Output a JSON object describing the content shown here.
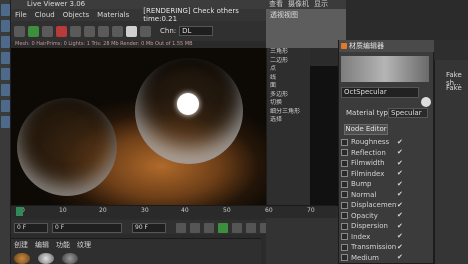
{
  "live_viewer": {
    "title": "Live Viewer 3.06",
    "menu": [
      "File",
      "Cloud",
      "Objects",
      "Materials"
    ],
    "status": "[RENDERING] Check others time:0.21",
    "chn_label": "Chn:",
    "chn_value": "DL",
    "stats": "Mesh: 0  HairPrims: 0  Lights: 1  Tris: 28 Mb  Render: 0 Mb  Out of 1.55 MB"
  },
  "viewport": {
    "label": "透视视图",
    "menu": [
      "查看",
      "摄像机",
      "显示"
    ]
  },
  "properties": {
    "items": [
      "三角形",
      "二边形",
      "点",
      "线",
      "面",
      "多边形",
      "切换",
      "细分三角形",
      "选择",
      "...",
      "..."
    ]
  },
  "material_editor": {
    "title": "材质编辑器",
    "material_name": "OctSpecular",
    "material_type_label": "Material type",
    "material_type_value": "Specular",
    "node_editor_label": "Node Editor",
    "channels": [
      {
        "label": "Roughness",
        "checked": "✔"
      },
      {
        "label": "Reflection",
        "checked": "✔"
      },
      {
        "label": "Filmwidth",
        "checked": "✔"
      },
      {
        "label": "Filmindex",
        "checked": "✔"
      },
      {
        "label": "Bump",
        "checked": "✔"
      },
      {
        "label": "Normal",
        "checked": "✔"
      },
      {
        "label": "Displacement",
        "checked": "✔"
      },
      {
        "label": "Opacity",
        "checked": "✔"
      },
      {
        "label": "Dispersion",
        "checked": "✔"
      },
      {
        "label": "Index",
        "checked": "✔"
      },
      {
        "label": "Transmission",
        "checked": "✔"
      },
      {
        "label": "Medium",
        "checked": "✔"
      }
    ]
  },
  "right_panel": {
    "line1": "Fake sh...",
    "line2": "Fake"
  },
  "timeline": {
    "ticks": [
      "0",
      "10",
      "20",
      "30",
      "40",
      "50",
      "60",
      "70"
    ],
    "start_field": "0 F",
    "current_field": "0 F",
    "end_field": "90 F"
  },
  "bottom_panel": {
    "menu": [
      "创建",
      "编辑",
      "功能",
      "纹理"
    ]
  },
  "colors": {
    "accent_green": "#3c8f3c",
    "record_red": "#b83a3a"
  }
}
